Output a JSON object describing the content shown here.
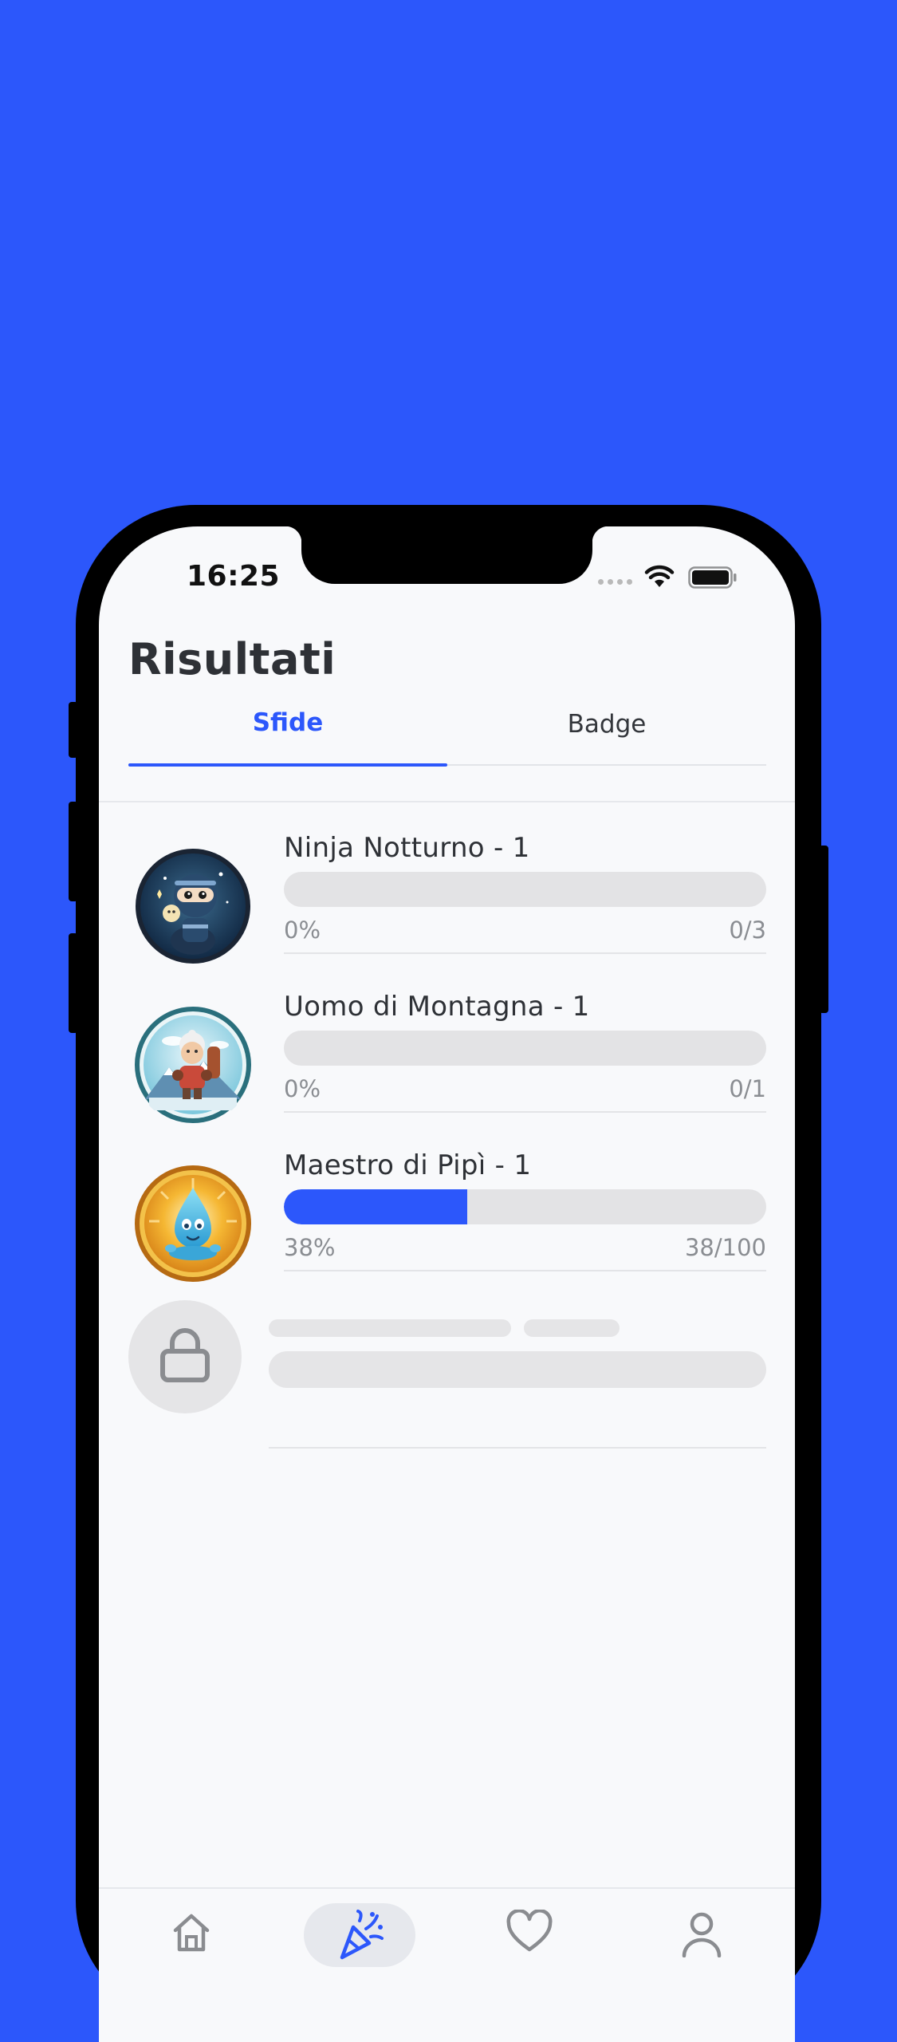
{
  "status_bar": {
    "time": "16:25"
  },
  "header": {
    "title": "Risultati"
  },
  "tabs": [
    {
      "label": "Sfide",
      "active": true
    },
    {
      "label": "Badge",
      "active": false
    }
  ],
  "challenges": [
    {
      "title": "Ninja Notturno - 1",
      "percent_label": "0%",
      "count_label": "0/3",
      "progress": 0.0,
      "badge_icon": "ninja-badge-icon"
    },
    {
      "title": "Uomo di Montagna - 1",
      "percent_label": "0%",
      "count_label": "0/1",
      "progress": 0.0,
      "badge_icon": "mountain-man-badge-icon"
    },
    {
      "title": "Maestro di Pipì - 1",
      "percent_label": "38%",
      "count_label": "38/100",
      "progress": 0.38,
      "badge_icon": "water-drop-badge-icon"
    }
  ],
  "locked_item": {
    "icon": "lock-icon"
  },
  "bottom_nav": [
    {
      "icon": "home-icon",
      "active": false
    },
    {
      "icon": "party-popper-icon",
      "active": true
    },
    {
      "icon": "heart-icon",
      "active": false
    },
    {
      "icon": "user-icon",
      "active": false
    }
  ],
  "colors": {
    "background": "#2c57fb",
    "accent": "#2c57fb",
    "track": "#e3e3e5",
    "text_primary": "#2e3136",
    "text_secondary": "#8a8d92"
  }
}
